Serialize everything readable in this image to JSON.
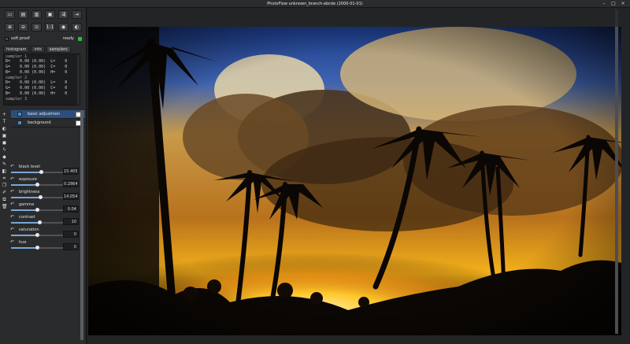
{
  "window": {
    "title": "PhotoFlow unknown_branch-abcde (2000-01-01)"
  },
  "toolbar": {
    "row1": [
      "new-icon",
      "open-icon",
      "open-with-icon",
      "save-icon",
      "export-icon",
      "settings-icon"
    ],
    "row2": [
      "zoom-in-icon",
      "zoom-out-icon",
      "zoom-fit-icon",
      "zoom-1-1-label",
      "view-icon",
      "preview-icon"
    ],
    "zoom_1_1": "1:1"
  },
  "softproof": {
    "label": "soft proof",
    "status": "ready",
    "status_color": "#29c132"
  },
  "tabs": [
    {
      "label": "histogram"
    },
    {
      "label": "info"
    },
    {
      "label": "samplers"
    }
  ],
  "samplers": {
    "list": [
      {
        "title": "sampler 1",
        "rows": [
          "R=    0.00 (0.00)  L=    0",
          "G=    0.00 (0.00)  C=    0",
          "B=    0.00 (0.00)  H=    0"
        ]
      },
      {
        "title": "sampler 2",
        "rows": [
          "R=    0.00 (0.00)  L=    0",
          "G=    0.00 (0.00)  C=    0",
          "B=    0.00 (0.00)  H=    0"
        ]
      },
      {
        "title": "sampler 3",
        "rows": []
      }
    ]
  },
  "layers": [
    {
      "name": "basic adjustmen",
      "selected": true
    },
    {
      "name": "background",
      "selected": false
    }
  ],
  "adjustments": [
    {
      "label": "black level",
      "value": "15.405",
      "fraction": 0.58
    },
    {
      "label": "exposure",
      "value": "0.2864",
      "fraction": 0.5
    },
    {
      "label": "brightness",
      "value": "14.054",
      "fraction": 0.56
    },
    {
      "label": "gamma",
      "value": "0.04",
      "fraction": 0.5
    },
    {
      "label": "contrast",
      "value": "10",
      "fraction": 0.55
    },
    {
      "label": "saturation",
      "value": "0",
      "fraction": 0.5
    },
    {
      "label": "hue",
      "value": "0",
      "fraction": 0.5
    }
  ],
  "colors": {
    "accent": "#4d88c9",
    "selected_row": "#2d4e7b"
  }
}
